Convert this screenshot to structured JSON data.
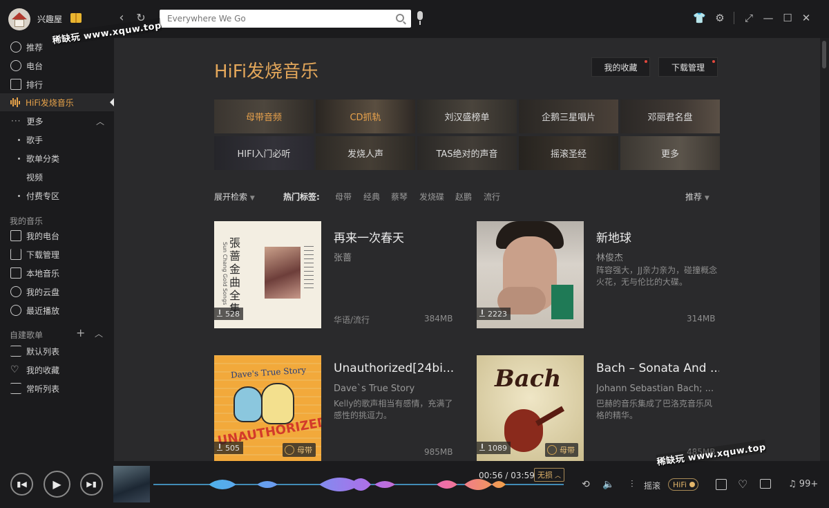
{
  "titlebar": {
    "username": "兴趣屋",
    "search_placeholder": "Everywhere We Go"
  },
  "sidebar": {
    "items": [
      {
        "label": "推荐"
      },
      {
        "label": "电台"
      },
      {
        "label": "排行"
      },
      {
        "label": "HiFi发烧音乐"
      },
      {
        "label": "更多"
      },
      {
        "label": "歌手"
      },
      {
        "label": "歌单分类"
      },
      {
        "label": "视频"
      },
      {
        "label": "付费专区"
      }
    ],
    "my_music_heading": "我的音乐",
    "my_music": [
      {
        "label": "我的电台"
      },
      {
        "label": "下载管理"
      },
      {
        "label": "本地音乐"
      },
      {
        "label": "我的云盘"
      },
      {
        "label": "最近播放"
      }
    ],
    "playlists_heading": "自建歌单",
    "playlists": [
      {
        "label": "默认列表"
      },
      {
        "label": "我的收藏"
      },
      {
        "label": "常听列表"
      }
    ]
  },
  "main": {
    "title": "HiFi发烧音乐",
    "my_favorites": "我的收藏",
    "downloads": "下载管理",
    "categories": [
      "母带音频",
      "CD抓轨",
      "刘汉盛榜单",
      "企鹅三星唱片",
      "邓丽君名盘",
      "HIFI入门必听",
      "发烧人声",
      "TAS绝对的声音",
      "摇滚圣经",
      "更多"
    ],
    "filter_expand": "展开检索",
    "hot_tags_label": "热门标签:",
    "hot_tags": [
      "母带",
      "经典",
      "蔡琴",
      "发烧碟",
      "赵鹏",
      "流行"
    ],
    "sort": "推荐",
    "cards": [
      {
        "title": "再来一次春天",
        "artist": "张蔷",
        "desc": "",
        "genre": "华语/流行",
        "size": "384MB",
        "downloads": "528",
        "badge": ""
      },
      {
        "title": "新地球",
        "artist": "林俊杰",
        "desc": "阵容强大，JJ亲力亲为，碰撞概念火花，无与伦比的大碟。",
        "genre": "",
        "size": "314MB",
        "downloads": "2223",
        "badge": ""
      },
      {
        "title": "Unauthorized[24bi...",
        "artist": "Dave`s True Story",
        "desc": "Kelly的歌声相当有感情，充满了感性的挑逗力。",
        "genre": "",
        "size": "985MB",
        "downloads": "505",
        "badge": "母带"
      },
      {
        "title": "Bach – Sonata And ...",
        "artist": "Johann Sebastian Bach; ...",
        "desc": "巴赫的音乐集成了巴洛克音乐风格的精华。",
        "genre": "",
        "size": "485MB",
        "downloads": "1089",
        "badge": "母带"
      }
    ],
    "cover_texts": {
      "zhang": "張蔷金曲全集",
      "zhang_en": "Sun Chang Gold Songs",
      "dave": "Dave's True Story",
      "unauth": "UNAUTHORIZED",
      "bach": "Bach"
    }
  },
  "player": {
    "time": "00:56 / 03:59",
    "quality": "无损",
    "effect": "摇滚",
    "hifi": "HiFi",
    "count": "99+"
  },
  "watermarks": [
    "稀缺玩 www.xquw.top",
    "稀缺玩 www.xquw.top"
  ],
  "colors": {
    "accent": "#e9a44a",
    "bg": "#2a2a2c",
    "sidebar": "#1b1b1d"
  }
}
